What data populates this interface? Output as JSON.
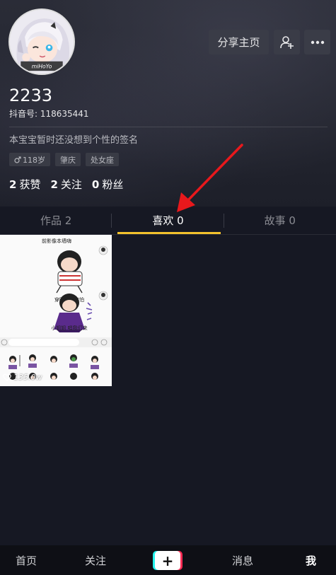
{
  "profile": {
    "nickname": "2233",
    "douyin_id": "抖音号: 118635441",
    "bio": "本宝宝暂时还没想到个性的签名",
    "avatar_watermark": "miHoYo",
    "tags": [
      {
        "icon": "male-icon",
        "label": "118岁"
      },
      {
        "icon": "",
        "label": "肇庆"
      },
      {
        "icon": "",
        "label": "处女座"
      }
    ],
    "stats": [
      {
        "num": "2",
        "label": "获赞"
      },
      {
        "num": "2",
        "label": "关注"
      },
      {
        "num": "0",
        "label": "粉丝"
      }
    ]
  },
  "header": {
    "share_label": "分享主页",
    "add_friend_icon": "add-friend-icon",
    "more_icon": "more-icon"
  },
  "tabs": [
    {
      "label": "作品 2",
      "active": false
    },
    {
      "label": "喜欢 0",
      "active": true
    },
    {
      "label": "故事 0",
      "active": false
    }
  ],
  "video": {
    "likes": "135.0w",
    "captions": [
      "前影像本墙嗨",
      "穿暗衣服害怕",
      "小姐姐 唱我们来"
    ]
  },
  "nav": {
    "home": "首页",
    "follow": "关注",
    "create": "+",
    "messages": "消息",
    "me": "我"
  },
  "colors": {
    "background": "#161823",
    "tab_underline": "#f3c22d",
    "arrow": "#e8181c"
  }
}
